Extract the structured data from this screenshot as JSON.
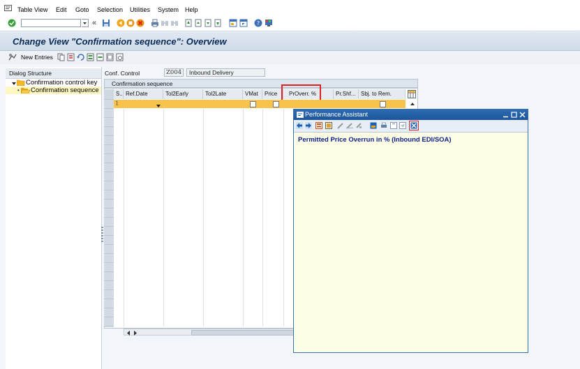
{
  "menu": {
    "items": [
      "Table View",
      "Edit",
      "Goto",
      "Selection",
      "Utilities",
      "System",
      "Help"
    ]
  },
  "toolbar": {
    "command_field_value": "",
    "command_field_placeholder": ""
  },
  "page": {
    "title": "Change View \"Confirmation sequence\": Overview"
  },
  "app_toolbar": {
    "new_entries_label": "New Entries"
  },
  "dialog_structure": {
    "heading": "Dialog Structure",
    "items": [
      {
        "label": "Confirmation control key",
        "selected": false,
        "type": "folder-closed"
      },
      {
        "label": "Confirmation sequence",
        "selected": true,
        "type": "folder-open"
      }
    ]
  },
  "conf_control": {
    "label": "Conf. Control",
    "value": "Z004",
    "description": "Inbound Delivery"
  },
  "table": {
    "caption": "Confirmation sequence",
    "columns": [
      "S..",
      "Ref.Date",
      "Tol2Early",
      "Tol2Late",
      "VMat",
      "Price",
      "PrOverr. %",
      "Pr.Shf...",
      "Sbj. to Rem."
    ],
    "first_row": {
      "seq": "1"
    }
  },
  "popup": {
    "title": "Performance Assistant",
    "text": "Permitted Price Overrun in % (Inbound EDI/SOA)"
  },
  "colors": {
    "highlight_row": "#f7c34a",
    "red_frame": "#e02020",
    "popup_bg": "#fdfde6",
    "popup_text": "#0b1f8a",
    "title_text": "#0a2a55"
  }
}
